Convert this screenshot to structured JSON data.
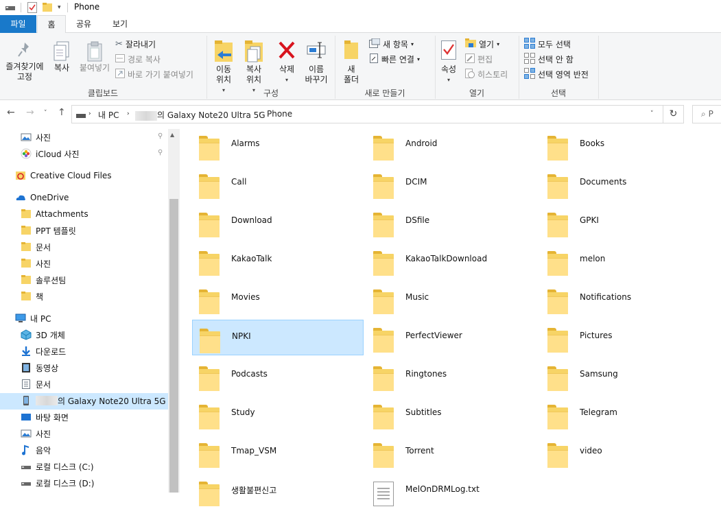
{
  "window": {
    "title": "Phone"
  },
  "tabs": {
    "file": "파일",
    "home": "홈",
    "share": "공유",
    "view": "보기"
  },
  "ribbon": {
    "clipboard": {
      "pin": "즐겨찾기에\n고정",
      "copy": "복사",
      "paste": "붙여넣기",
      "cut": "잘라내기",
      "copy_path": "경로 복사",
      "paste_shortcut": "바로 가기 붙여넣기",
      "group": "클립보드"
    },
    "organize": {
      "move_to": "이동\n위치",
      "copy_to": "복사\n위치",
      "delete": "삭제",
      "rename": "이름\n바꾸기",
      "group": "구성"
    },
    "new": {
      "new_folder": "새\n폴더",
      "new_item": "새 항목",
      "easy_access": "빠른 연결",
      "group": "새로 만들기"
    },
    "open": {
      "properties": "속성",
      "open": "열기",
      "edit": "편집",
      "history": "히스토리",
      "group": "열기"
    },
    "select": {
      "select_all": "모두 선택",
      "select_none": "선택 안 함",
      "invert": "선택 영역 반전",
      "group": "선택"
    }
  },
  "address": {
    "crumbs": [
      "내 PC",
      "의 Galaxy Note20 Ultra 5G",
      "Phone"
    ],
    "search_placeholder": "P"
  },
  "nav": {
    "items": [
      {
        "label": "사진",
        "icon": "pictures-icon"
      },
      {
        "label": "iCloud 사진",
        "icon": "icloud-photos-icon"
      },
      {
        "label": "Creative Cloud Files",
        "icon": "creative-cloud-icon"
      },
      {
        "label": "OneDrive",
        "icon": "onedrive-icon"
      },
      {
        "label": "Attachments",
        "icon": "folder-icon"
      },
      {
        "label": "PPT 템플릿",
        "icon": "folder-icon"
      },
      {
        "label": "문서",
        "icon": "folder-icon"
      },
      {
        "label": "사진",
        "icon": "folder-icon"
      },
      {
        "label": "솔루션팀",
        "icon": "folder-icon"
      },
      {
        "label": "책",
        "icon": "folder-icon"
      },
      {
        "label": "내 PC",
        "icon": "this-pc-icon"
      },
      {
        "label": "3D 개체",
        "icon": "3d-objects-icon"
      },
      {
        "label": "다운로드",
        "icon": "downloads-icon"
      },
      {
        "label": "동영상",
        "icon": "videos-icon"
      },
      {
        "label": "문서",
        "icon": "documents-icon"
      },
      {
        "label": "의 Galaxy Note20 Ultra 5G",
        "icon": "phone-icon"
      },
      {
        "label": "바탕 화면",
        "icon": "desktop-icon"
      },
      {
        "label": "사진",
        "icon": "pictures-icon"
      },
      {
        "label": "음악",
        "icon": "music-icon"
      },
      {
        "label": "로컬 디스크 (C:)",
        "icon": "drive-icon"
      },
      {
        "label": "로컬 디스크 (D:)",
        "icon": "drive-icon"
      }
    ]
  },
  "files": [
    "Alarms",
    "Android",
    "Books",
    "Call",
    "DCIM",
    "Documents",
    "Download",
    "DSfile",
    "GPKI",
    "KakaoTalk",
    "KakaoTalkDownload",
    "melon",
    "Movies",
    "Music",
    "Notifications",
    "NPKI",
    "PerfectViewer",
    "Pictures",
    "Podcasts",
    "Ringtones",
    "Samsung",
    "Study",
    "Subtitles",
    "Telegram",
    "Tmap_VSM",
    "Torrent",
    "video",
    "생활불편신고",
    "MelOnDRMLog.txt"
  ],
  "colors": {
    "accent": "#1979ca",
    "selection": "#cce8ff",
    "folder": "#f7d466"
  }
}
